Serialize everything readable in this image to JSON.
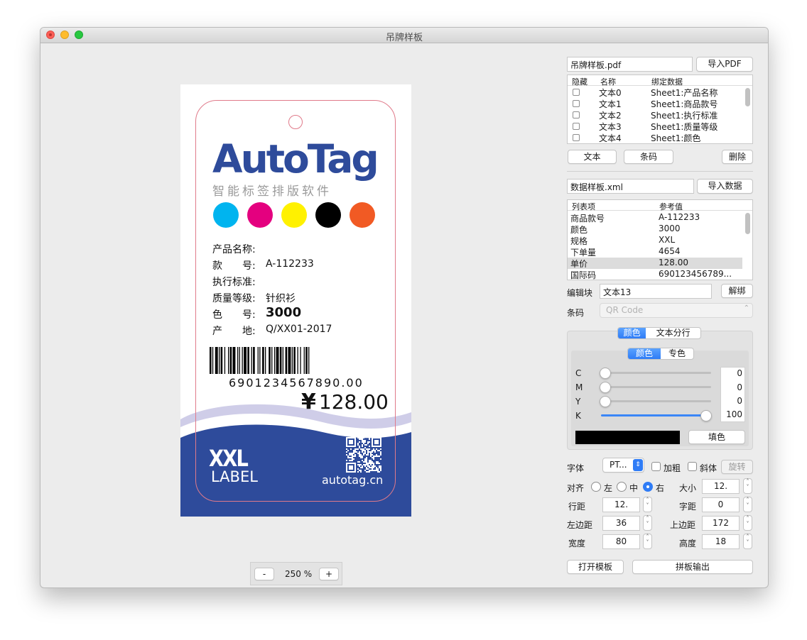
{
  "window": {
    "title": "吊牌样板"
  },
  "tag": {
    "logo": "AutoTag",
    "slogan": "智能标签排版软件",
    "swatches": [
      "#00b4ef",
      "#e4007f",
      "#fff100",
      "#000000",
      "#f15a24"
    ],
    "fields": [
      {
        "label": "产品名称:",
        "value": ""
      },
      {
        "label": "款　　号:",
        "value": "A-112233"
      },
      {
        "label": "执行标准:",
        "value": ""
      },
      {
        "label": "质量等级:",
        "value": "针织衫"
      },
      {
        "label": "色　　号:",
        "value": "3000"
      },
      {
        "label": "产　　地:",
        "value": "Q/XX01-2017"
      }
    ],
    "barcode_number": "6901234567890.00",
    "price_symbol": "¥",
    "price": "128.00",
    "size": "XXL",
    "size_sub": "LABEL",
    "website": "autotag.cn",
    "colors": {
      "brand_blue": "#2e4b9b",
      "wave_light": "#cfcde8",
      "cut_line": "#e07a8a"
    }
  },
  "zoom": {
    "minus": "-",
    "value": "250 %",
    "plus": "+"
  },
  "panel": {
    "pdf_file": "吊牌样板.pdf",
    "import_pdf": "导入PDF",
    "layers_table": {
      "headers": [
        "隐藏",
        "名称",
        "绑定数据"
      ],
      "rows": [
        {
          "name": "文本0",
          "bind": "Sheet1:产品名称"
        },
        {
          "name": "文本1",
          "bind": "Sheet1:商品款号"
        },
        {
          "name": "文本2",
          "bind": "Sheet1:执行标准"
        },
        {
          "name": "文本3",
          "bind": "Sheet1:质量等级"
        },
        {
          "name": "文本4",
          "bind": "Sheet1:颜色"
        }
      ]
    },
    "add_text": "文本",
    "add_barcode": "条码",
    "delete": "删除",
    "data_file": "数据样板.xml",
    "import_data": "导入数据",
    "data_table": {
      "headers": [
        "列表项",
        "参考值"
      ],
      "rows": [
        {
          "key": "商品款号",
          "value": "A-112233"
        },
        {
          "key": "颜色",
          "value": "3000"
        },
        {
          "key": "规格",
          "value": "XXL"
        },
        {
          "key": "下单量",
          "value": "4654"
        },
        {
          "key": "单价",
          "value": "128.00"
        },
        {
          "key": "国际码",
          "value": "690123456789..."
        }
      ]
    },
    "edit_block_label": "编辑块",
    "edit_block_value": "文本13",
    "unbind": "解绑",
    "barcode_label": "条码",
    "barcode_type": "QR Code",
    "tabs": [
      "颜色",
      "文本分行"
    ],
    "color_tabs": [
      "颜色",
      "专色"
    ],
    "cmyk": [
      {
        "channel": "C",
        "value": "0"
      },
      {
        "channel": "M",
        "value": "0"
      },
      {
        "channel": "Y",
        "value": "0"
      },
      {
        "channel": "K",
        "value": "100"
      }
    ],
    "fill_color": "#000000",
    "fill_button": "填色",
    "font_label": "字体",
    "font_value": "PT...",
    "bold_label": "加粗",
    "italic_label": "斜体",
    "rotate_button": "旋转",
    "align_label": "对齐",
    "align_options": [
      "左",
      "中",
      "右"
    ],
    "size_label": "大小",
    "size_value": "12.",
    "line_spacing_label": "行距",
    "line_spacing_value": "12.",
    "char_spacing_label": "字距",
    "char_spacing_value": "0",
    "left_margin_label": "左边距",
    "left_margin_value": "36",
    "top_margin_label": "上边距",
    "top_margin_value": "172",
    "width_label": "宽度",
    "width_value": "80",
    "height_label": "高度",
    "height_value": "18",
    "open_template": "打开模板",
    "export": "拼板输出"
  }
}
